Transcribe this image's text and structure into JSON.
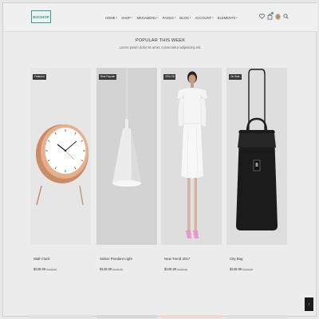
{
  "brand": {
    "logo_text": "BIGSHOP"
  },
  "nav": {
    "items": [
      {
        "label": "HOME",
        "has_caret": true
      },
      {
        "label": "SHOP",
        "has_caret": true
      },
      {
        "label": "MEGAMENU",
        "has_caret": true
      },
      {
        "label": "PAGES",
        "has_caret": true
      },
      {
        "label": "BLOG",
        "has_caret": true
      },
      {
        "label": "ACCOUNT",
        "has_caret": true
      },
      {
        "label": "ELEMENTS",
        "has_caret": true
      }
    ],
    "caret_glyph": "▾"
  },
  "header_icons": {
    "wishlist": "heart-icon",
    "cart": "bag-icon",
    "user": "avatar",
    "search": "search-icon"
  },
  "section": {
    "title": "POPULAR THIS WEEK",
    "subtitle": "Lorem ipsum dolor sit amet, consectetur adipisicing elit."
  },
  "products": [
    {
      "label": "Featured",
      "name": "Wall Clock",
      "price": "$139.99",
      "old_price": "$149.00"
    },
    {
      "label": "Best Popular",
      "name": "Sinker Pendant Light",
      "price": "$139.99",
      "old_price": "$149.00"
    },
    {
      "label": "20% Off",
      "name": "New Trend 2017",
      "price": "$139.99",
      "old_price": "$149.00"
    },
    {
      "label": "On Sale",
      "name": "City Bag",
      "price": "$139.99",
      "old_price": "$149.00"
    }
  ],
  "scroll_top": "↑",
  "colors": {
    "accent": "#2aa58f",
    "label_bg": "#3a3a3a"
  }
}
